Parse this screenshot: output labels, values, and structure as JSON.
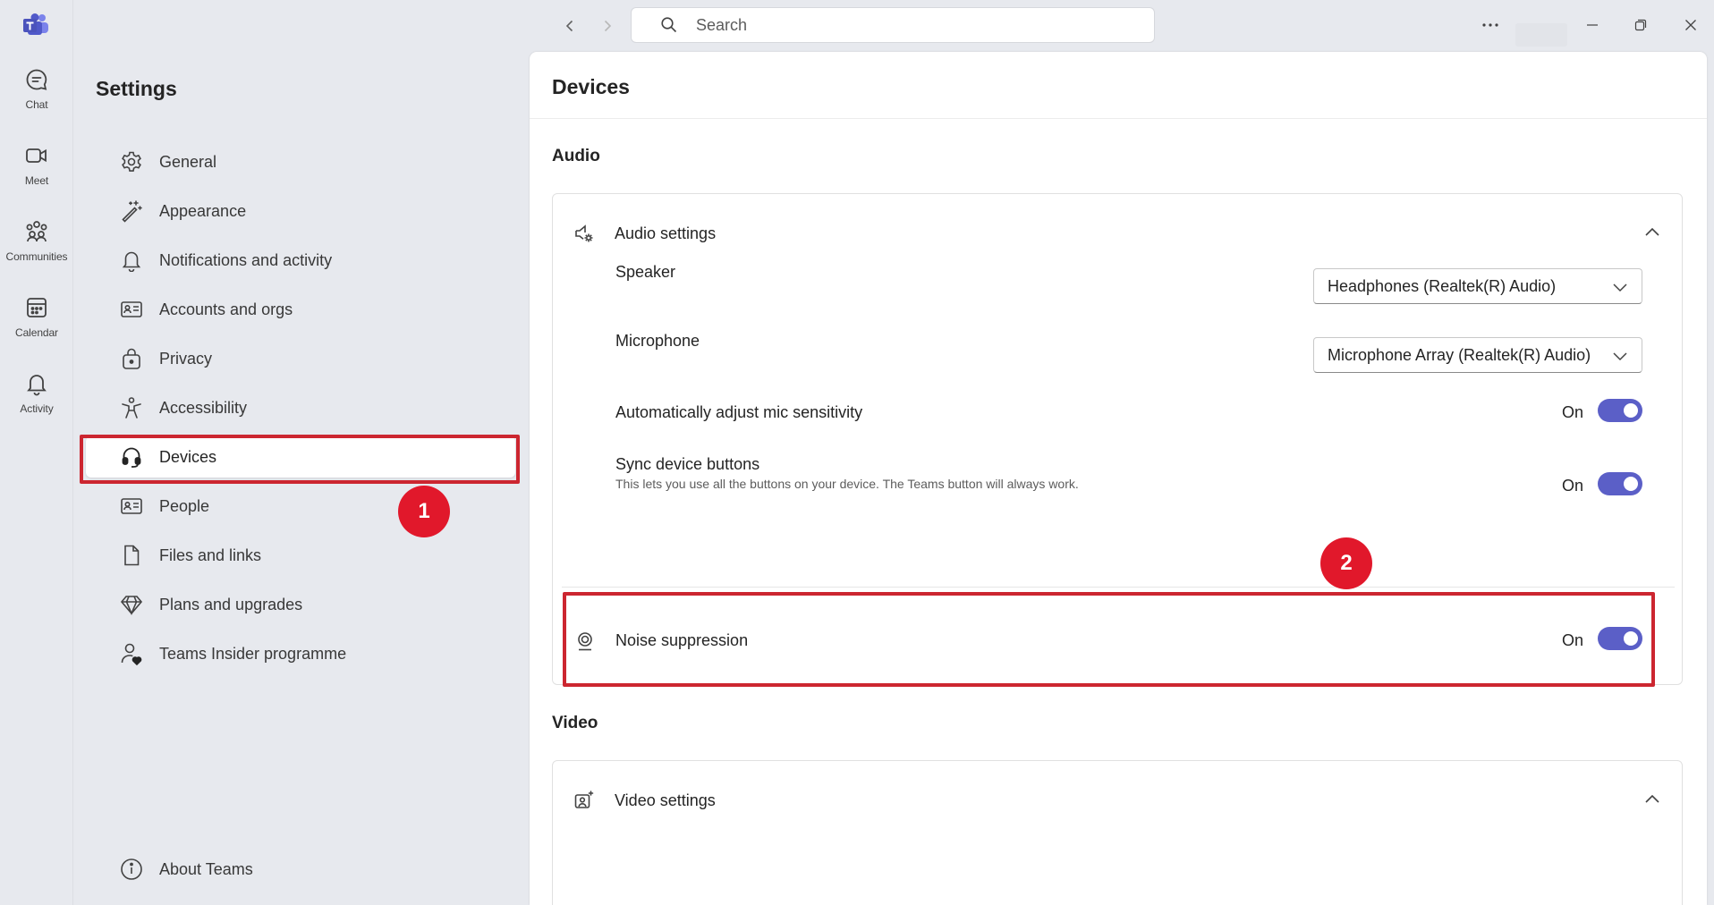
{
  "colors": {
    "accent": "#5b5fc7",
    "highlight": "#cc2630",
    "badge": "#e1182b"
  },
  "rail": {
    "items": [
      {
        "label": "Chat",
        "icon": "chat-icon"
      },
      {
        "label": "Meet",
        "icon": "video-camera-icon"
      },
      {
        "label": "Communities",
        "icon": "communities-icon"
      },
      {
        "label": "Calendar",
        "icon": "calendar-icon"
      },
      {
        "label": "Activity",
        "icon": "bell-icon"
      }
    ]
  },
  "titlebar": {
    "search_placeholder": "Search"
  },
  "settings": {
    "title": "Settings",
    "menu": [
      {
        "label": "General",
        "icon": "gear-icon"
      },
      {
        "label": "Appearance",
        "icon": "magic-wand-icon"
      },
      {
        "label": "Notifications and activity",
        "icon": "bell-icon"
      },
      {
        "label": "Accounts and orgs",
        "icon": "id-card-icon"
      },
      {
        "label": "Privacy",
        "icon": "lock-icon"
      },
      {
        "label": "Accessibility",
        "icon": "accessibility-icon"
      },
      {
        "label": "Devices",
        "icon": "headset-icon",
        "active": true
      },
      {
        "label": "People",
        "icon": "contact-card-icon"
      },
      {
        "label": "Files and links",
        "icon": "document-icon"
      },
      {
        "label": "Plans and upgrades",
        "icon": "diamond-icon"
      },
      {
        "label": "Teams Insider programme",
        "icon": "person-heart-icon"
      }
    ],
    "about": {
      "label": "About Teams",
      "icon": "info-icon"
    }
  },
  "annotations": {
    "badge1": "1",
    "badge2": "2"
  },
  "main": {
    "title": "Devices",
    "audio": {
      "section_title": "Audio",
      "card_title": "Audio settings",
      "speaker": {
        "label": "Speaker",
        "value": "Headphones (Realtek(R) Audio)"
      },
      "microphone": {
        "label": "Microphone",
        "value": "Microphone Array (Realtek(R) Audio)"
      },
      "auto_adjust": {
        "label": "Automatically adjust mic sensitivity",
        "state": "On"
      },
      "sync_buttons": {
        "label": "Sync device buttons",
        "description": "This lets you use all the buttons on your device. The Teams button will always work.",
        "state": "On"
      },
      "noise_suppression": {
        "label": "Noise suppression",
        "state": "On"
      }
    },
    "video": {
      "section_title": "Video",
      "card_title": "Video settings"
    }
  }
}
